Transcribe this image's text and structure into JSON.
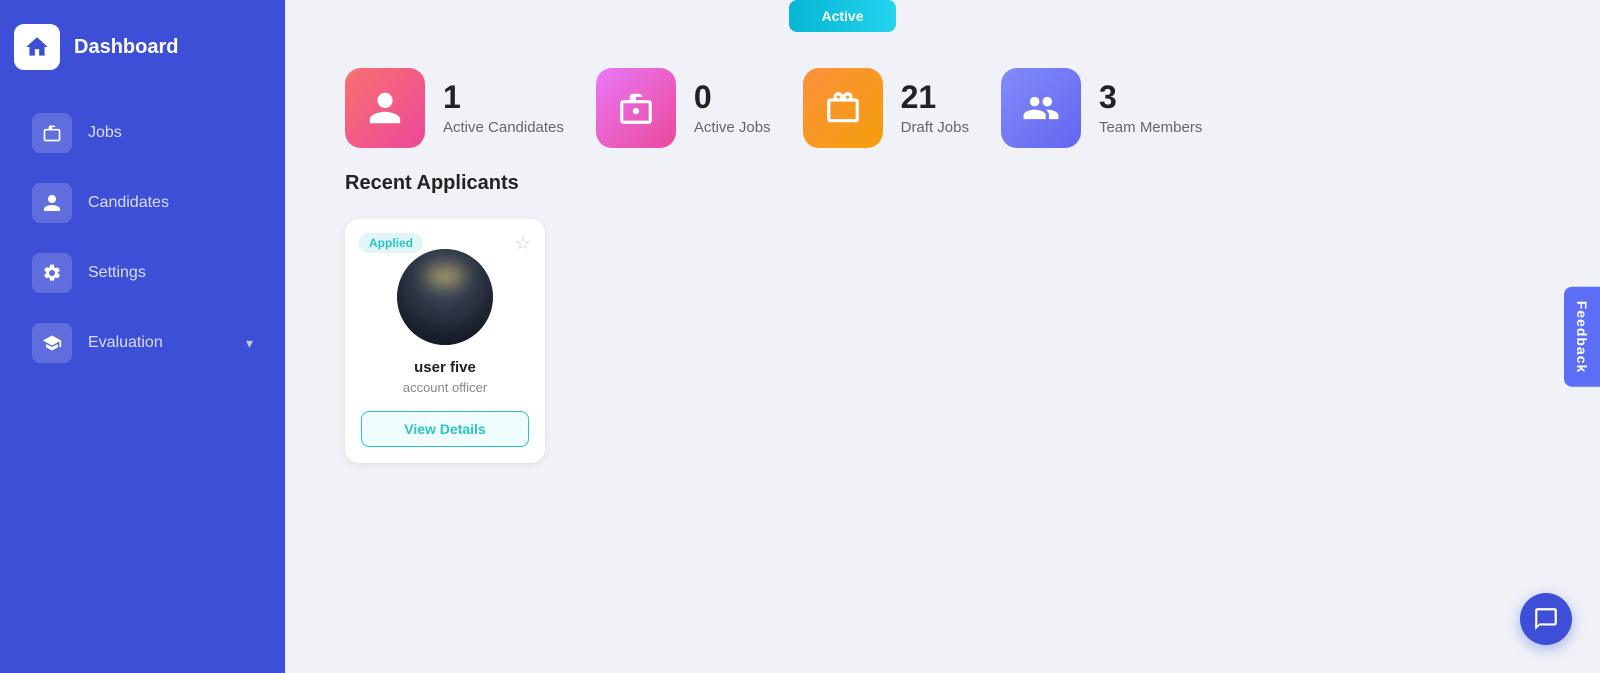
{
  "sidebar": {
    "title": "Dashboard",
    "logo_alt": "home-icon",
    "nav_items": [
      {
        "id": "jobs",
        "label": "Jobs",
        "icon": "briefcase-icon",
        "active": false
      },
      {
        "id": "candidates",
        "label": "Candidates",
        "icon": "user-icon",
        "active": false
      },
      {
        "id": "settings",
        "label": "Settings",
        "icon": "gear-icon",
        "active": false
      },
      {
        "id": "evaluation",
        "label": "Evaluation",
        "icon": "graduation-icon",
        "active": false,
        "has_chevron": true
      }
    ]
  },
  "stats": [
    {
      "id": "active-candidates",
      "number": "1",
      "label": "Active Candidates",
      "icon_color": "pink"
    },
    {
      "id": "active-jobs",
      "number": "0",
      "label": "Active Jobs",
      "icon_color": "magenta"
    },
    {
      "id": "draft-jobs",
      "number": "21",
      "label": "Draft Jobs",
      "icon_color": "orange"
    },
    {
      "id": "team-members",
      "number": "3",
      "label": "Team Members",
      "icon_color": "indigo"
    }
  ],
  "recent_applicants": {
    "title": "Recent Applicants",
    "applicants": [
      {
        "id": "user-five",
        "badge": "Applied",
        "name": "user five",
        "role": "account officer",
        "view_details_label": "View Details"
      }
    ]
  },
  "feedback_label": "Feedback",
  "chat_icon": "chat-icon"
}
